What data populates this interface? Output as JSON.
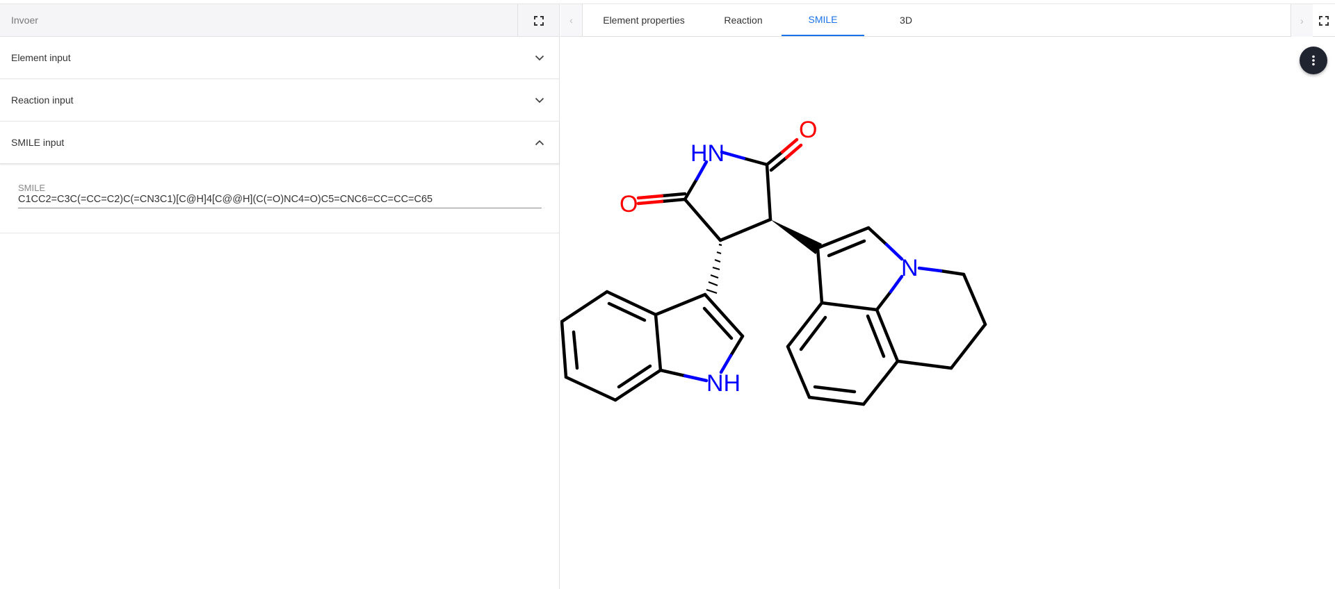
{
  "left_panel": {
    "title": "Invoer",
    "sections": [
      {
        "label": "Element input",
        "state": "collapsed"
      },
      {
        "label": "Reaction input",
        "state": "collapsed"
      },
      {
        "label": "SMILE input",
        "state": "expanded"
      }
    ],
    "smile_input": {
      "label": "SMILE",
      "value": "C1CC2=C3C(=CC=C2)C(=CN3C1)[C@H]4[C@@H](C(=O)NC4=O)C5=CNC6=CC=CC=C65"
    }
  },
  "right_panel": {
    "tabs": [
      "Element properties",
      "Reaction",
      "SMILE",
      "3D"
    ],
    "active_tab": "SMILE",
    "molecule_atom_labels": {
      "o_top": "O",
      "nh_top": "HN",
      "o_left": "O",
      "n_ring": "N",
      "nh_indole": "NH"
    }
  },
  "colors": {
    "accent": "#1a73e8",
    "nitrogen": "#0000ff",
    "oxygen": "#ff0000",
    "bond": "#000000",
    "fab": "#1f2430"
  },
  "icons": [
    "fullscreen-icon",
    "chevron-down-icon",
    "chevron-up-icon",
    "chevron-left-icon",
    "chevron-right-icon",
    "more-vert-icon"
  ]
}
